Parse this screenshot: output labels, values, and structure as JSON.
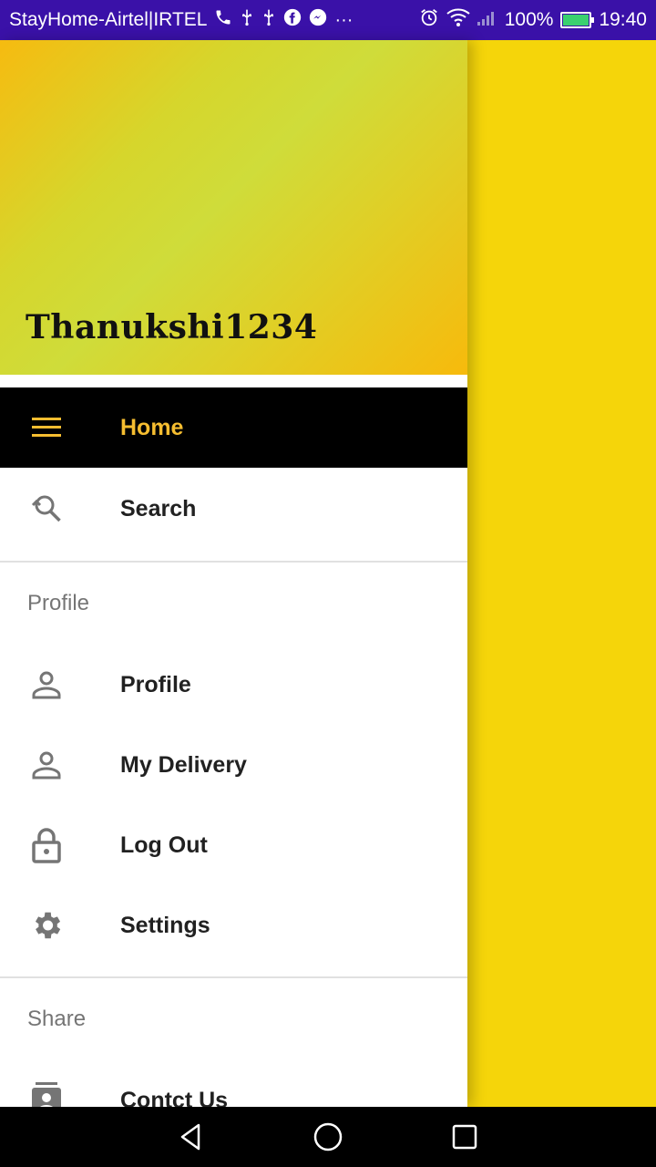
{
  "status_bar": {
    "carrier": "StayHome-Airtel|IRTEL",
    "battery_percent": "100%",
    "time": "19:40",
    "more_icon": "···",
    "background_color": "#3a11a8"
  },
  "drawer": {
    "username": "Thanukshi1234",
    "items": [
      {
        "label": "Home",
        "icon": "menu-icon",
        "active": true
      },
      {
        "label": "Search",
        "icon": "search-icon",
        "active": false
      }
    ],
    "sections": [
      {
        "title": "Profile",
        "items": [
          {
            "label": "Profile",
            "icon": "person-icon"
          },
          {
            "label": "My Delivery",
            "icon": "person-icon"
          },
          {
            "label": "Log Out",
            "icon": "lock-icon"
          },
          {
            "label": "Settings",
            "icon": "gear-icon"
          }
        ]
      },
      {
        "title": "Share",
        "items": [
          {
            "label": "Contct Us",
            "icon": "contact-icon"
          }
        ]
      }
    ]
  },
  "colors": {
    "accent_yellow": "#f5d50a",
    "active_label": "#f5bd30",
    "active_bg": "#000000"
  }
}
